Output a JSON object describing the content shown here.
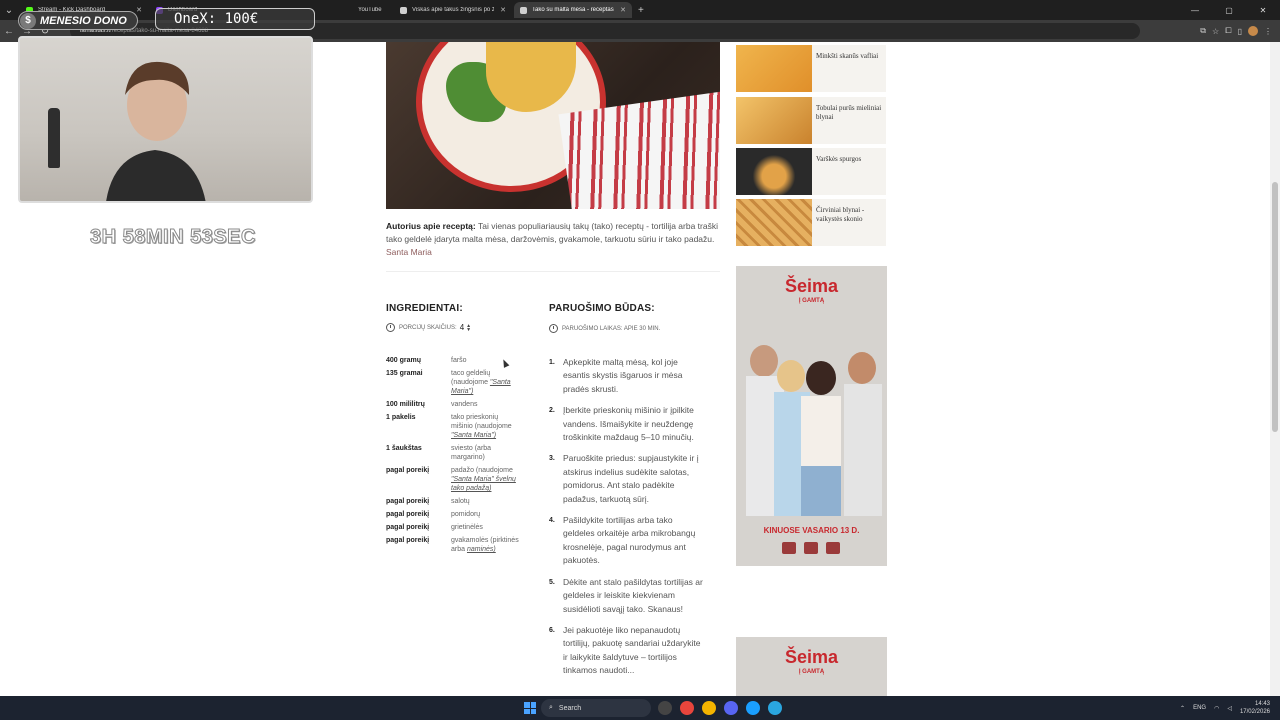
{
  "browser": {
    "tabs": [
      {
        "title": "Stream - Kick Dashboard",
        "color": "#53fc18",
        "active": false
      },
      {
        "title": "Dashboard",
        "color": "#9146ff",
        "active": false
      },
      {
        "title": "YouTube",
        "color": "#ff0000",
        "active": false
      },
      {
        "title": "Viskas apie takus žingsnis po ži",
        "color": "#cfcfcf",
        "active": false
      },
      {
        "title": "Tako su malta mėsa - receptas",
        "color": "#cfcfcf",
        "active": true
      }
    ],
    "new_tab": "+",
    "url_domain": "lamaistas.lt",
    "url_path": "/receptas/tako-su-malta-mesa-84688"
  },
  "overlay": {
    "badge_icon": "$",
    "badge_label": "MENESIO DONO",
    "onex_label": "OneX: 100€",
    "timer": "3H 58MIN 53SEC"
  },
  "recipe": {
    "author_label": "Autorius apie receptą:",
    "author_text": "Tai vienas populiariausių takų (tako) receptų - tortilija arba traški tako geldelė įdaryta malta mėsa, daržovėmis, gvakamole, tarkuotu sūriu ir tako padažu.",
    "author_link": "Santa Maria",
    "ingredients_title": "INGREDIENTAI:",
    "servings_label": "PORCIJŲ SKAIČIUS:",
    "servings_count": "4",
    "ingredients": [
      {
        "amount": "400 gramų",
        "name": "faršo",
        "note": ""
      },
      {
        "amount": "135 gramai",
        "name": "taco geldelių (naudojome ",
        "note": "\"Santa Maria\")"
      },
      {
        "amount": "100 mililitrų",
        "name": "vandens",
        "note": ""
      },
      {
        "amount": "1 pakelis",
        "name": "tako prieskonių mišinio (naudojome ",
        "note": "\"Santa Maria\")"
      },
      {
        "amount": "1 šaukštas",
        "name": "sviesto (arba margarino)",
        "note": ""
      },
      {
        "amount": "pagal poreikį",
        "name": "padažo (naudojome ",
        "note": "\"Santa Maria\" švelnų tako padažą)"
      },
      {
        "amount": "pagal poreikį",
        "name": "salotų",
        "note": ""
      },
      {
        "amount": "pagal poreikį",
        "name": "pomidorų",
        "note": ""
      },
      {
        "amount": "pagal poreikį",
        "name": "grietinėlės",
        "note": ""
      },
      {
        "amount": "pagal poreikį",
        "name": "gvakamolės (pirktinės arba ",
        "note": "naminės)"
      }
    ],
    "method_title": "PARUOŠIMO BŪDAS:",
    "prep_time_label": "PARUOŠIMO LAIKAS: APIE 30 MIN.",
    "steps": [
      {
        "num": "1.",
        "text": "Apkepkite maltą mėsą, kol joje esantis skystis išgaruos ir mėsa pradės skrusti."
      },
      {
        "num": "2.",
        "text": "Įberkite prieskonių mišinio ir įpilkite vandens. Išmaišykite ir neuždengę troškinkite maždaug 5–10 minučių."
      },
      {
        "num": "3.",
        "text": "Paruoškite priedus: supjaustykite ir į atskirus indelius sudėkite salotas, pomidorus. Ant stalo padėkite padažus, tarkuotą sūrį."
      },
      {
        "num": "4.",
        "text": "Pašildykite tortilijas arba tako geldeles orkaitėje arba mikrobangų krosnelėje, pagal nurodymus ant pakuotės."
      },
      {
        "num": "5.",
        "text": "Dėkite ant stalo pašildytas tortilijas ar geldeles ir leiskite kiekvienam susidėlioti savąjį tako. Skanaus!"
      },
      {
        "num": "6.",
        "text": "Jei pakuotėje liko nepanaudotų tortilijų, pakuotę sandariai uždarykite ir laikykite šaldytuve – tortilijos tinkamos naudoti..."
      }
    ]
  },
  "sidebar": {
    "cards": [
      {
        "label": "Minkšti skanūs vafliai"
      },
      {
        "label": "Tobulai purūs mieliniai blynai"
      },
      {
        "label": "Varškės spurgos"
      },
      {
        "label": "Čirviniai blynai - vaikystės skonio"
      }
    ],
    "ad1": {
      "heading": "Šeima",
      "sub": "Į GAMTĄ",
      "footer": "KINUOSE VASARIO 13 D."
    },
    "ad2": {
      "heading": "Šeima",
      "sub": "Į GAMTĄ"
    }
  },
  "taskbar": {
    "search_label": "Search",
    "lang": "ENG",
    "time": "14:43",
    "date": "17/02/2026"
  }
}
